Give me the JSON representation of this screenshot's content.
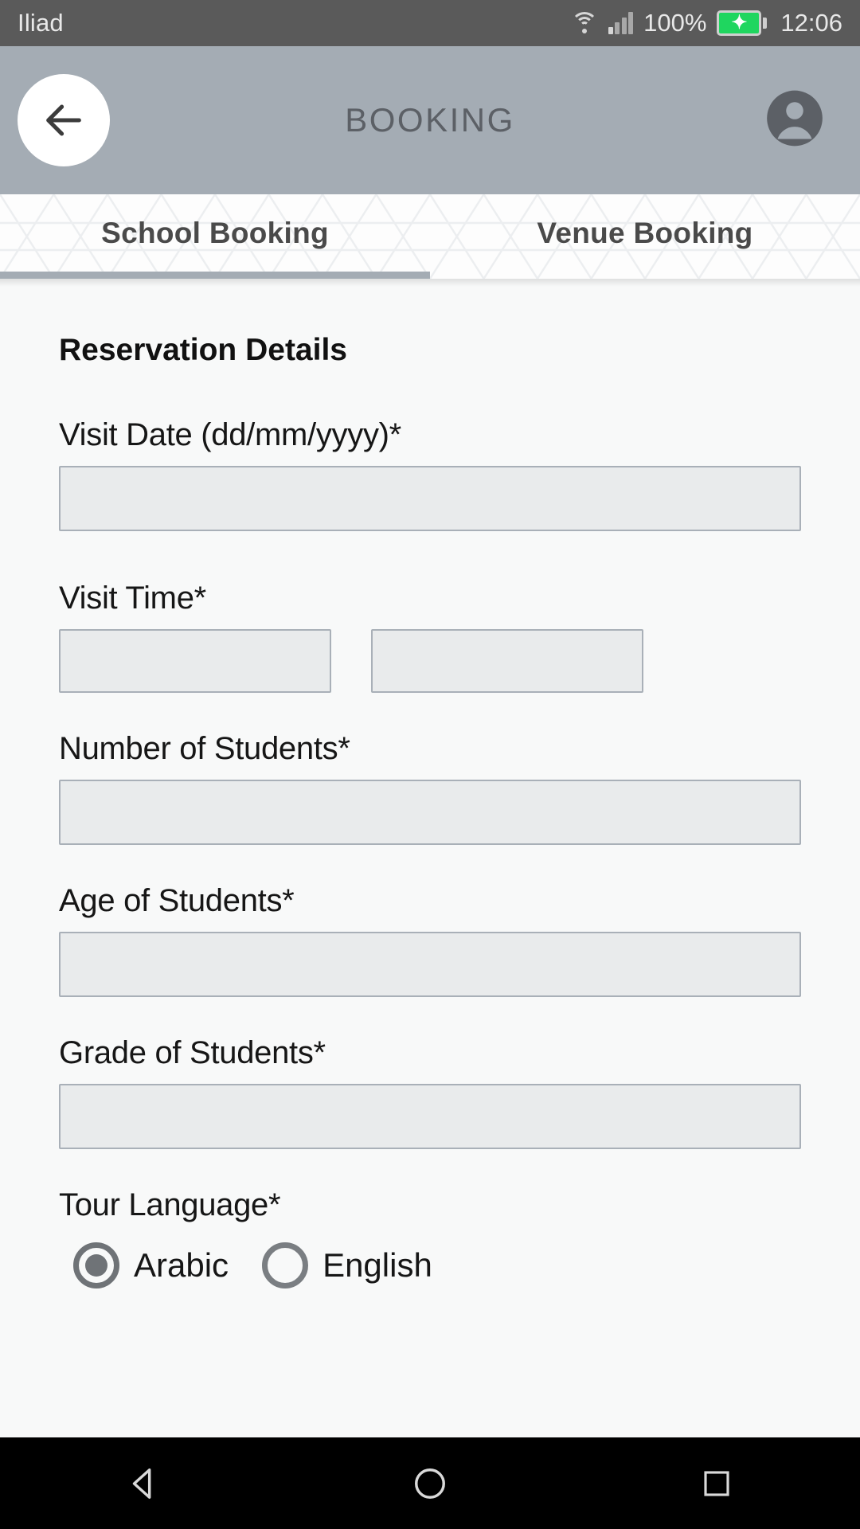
{
  "status_bar": {
    "carrier": "Iliad",
    "battery_percent": "100%",
    "clock": "12:06",
    "wifi_icon": "wifi-icon",
    "signal_icon": "cellular-signal-icon",
    "battery_icon": "battery-charging-icon",
    "battery_color": "#1fd65f"
  },
  "app_bar": {
    "title": "BOOKING",
    "back_icon": "back-arrow-icon",
    "profile_icon": "account-circle-icon",
    "background_color": "#a4acb4"
  },
  "tabs": {
    "items": [
      {
        "label": "School Booking",
        "active": true
      },
      {
        "label": "Venue Booking",
        "active": false
      }
    ],
    "indicator_color": "#a4acb4"
  },
  "form": {
    "section_title": "Reservation Details",
    "fields": [
      {
        "label": "Visit Date (dd/mm/yyyy)*",
        "value": "",
        "placeholder": ""
      },
      {
        "label": "Visit Time*",
        "value_from": "",
        "value_to": "",
        "placeholder": ""
      },
      {
        "label": "Number of Students*",
        "value": "",
        "placeholder": ""
      },
      {
        "label": "Age of Students*",
        "value": "",
        "placeholder": ""
      },
      {
        "label": "Grade of Students*",
        "value": "",
        "placeholder": ""
      }
    ],
    "tour_language": {
      "label": "Tour Language*",
      "options": [
        {
          "label": "Arabic",
          "selected": true
        },
        {
          "label": "English",
          "selected": false
        }
      ]
    }
  },
  "nav_bar": {
    "back_icon": "nav-back-triangle-icon",
    "home_icon": "nav-home-circle-icon",
    "recents_icon": "nav-recents-square-icon"
  }
}
